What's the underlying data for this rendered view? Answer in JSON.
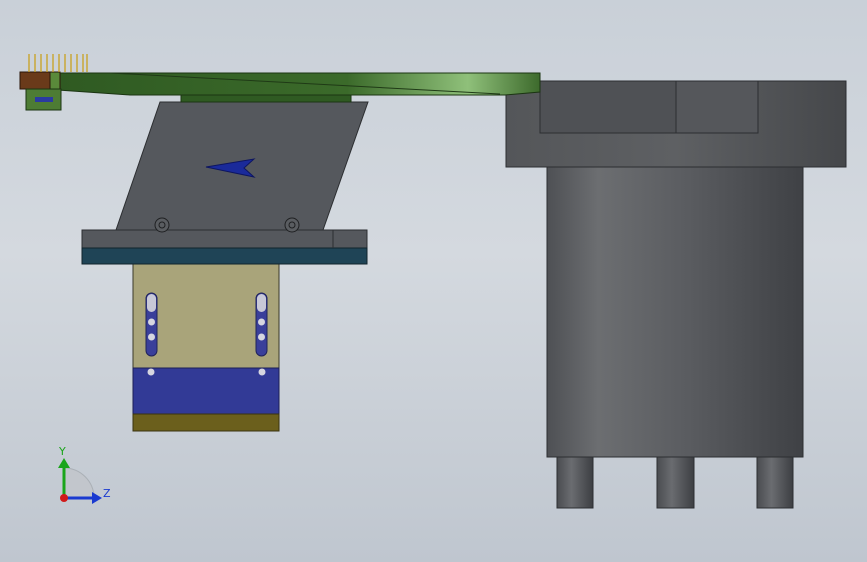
{
  "view": {
    "background_top": "#c9d0d8",
    "background_bottom": "#bfc6cf"
  },
  "model": {
    "pcb_color": "#3f6b2c",
    "plate_color": "#55585d",
    "base_color": "#1f4456",
    "slider_color": "#a9a47a",
    "slider_band_color": "#323a96",
    "slider_foot_color": "#6b5f1c",
    "motor_color": "#5b5d60",
    "arrow_color": "#1a2a9a"
  },
  "triad": {
    "y_label": "Y",
    "z_label": "Z",
    "y_color": "#1aa51a",
    "z_color": "#1a3ad0",
    "x_color": "#d01a1a"
  }
}
